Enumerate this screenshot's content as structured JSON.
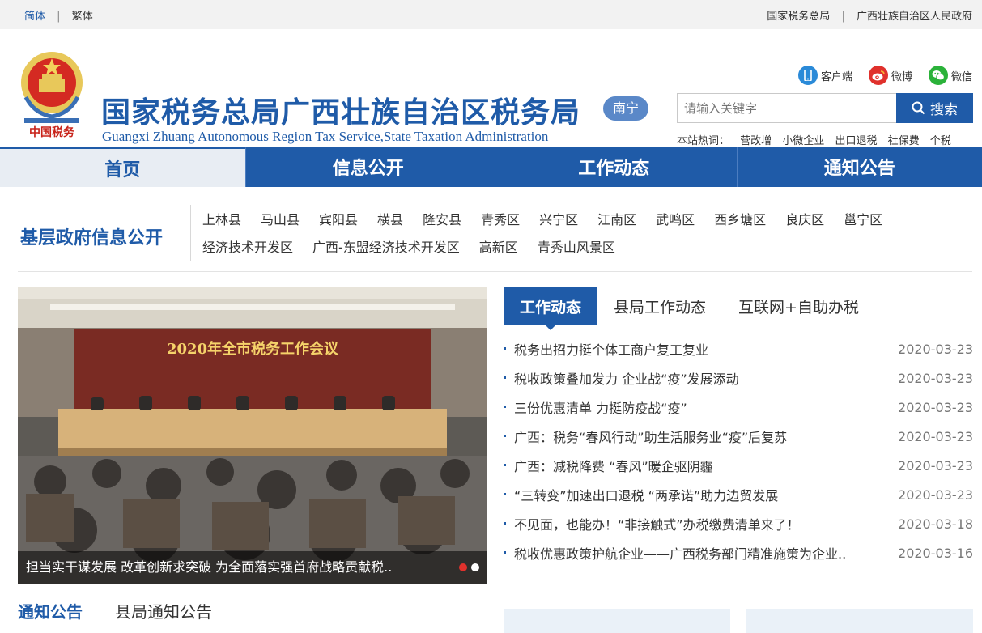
{
  "topbar": {
    "lang_simplified": "简体",
    "lang_traditional": "繁体",
    "link_sat": "国家税务总局",
    "link_gov": "广西壮族自治区人民政府"
  },
  "header": {
    "title_cn": "国家税务总局广西壮族自治区税务局",
    "title_en": "Guangxi Zhuang Autonomous Region Tax Service,State Taxation Administration",
    "city": "南宁",
    "emblem_text": "中国税务",
    "social": [
      {
        "label": "客户端",
        "icon": "phone-icon"
      },
      {
        "label": "微博",
        "icon": "weibo-icon"
      },
      {
        "label": "微信",
        "icon": "wechat-icon"
      }
    ],
    "search_placeholder": "请输入关键字",
    "search_button": "搜索",
    "hot_label": "本站热词：",
    "hot_words": [
      "营改增",
      "小微企业",
      "出口退税",
      "社保费",
      "个税"
    ]
  },
  "nav": [
    {
      "label": "首页",
      "active": true
    },
    {
      "label": "信息公开",
      "active": false
    },
    {
      "label": "工作动态",
      "active": false
    },
    {
      "label": "通知公告",
      "active": false
    }
  ],
  "grassroots": {
    "title": "基层政府信息公开",
    "items": [
      "上林县",
      "马山县",
      "宾阳县",
      "横县",
      "隆安县",
      "青秀区",
      "兴宁区",
      "江南区",
      "武鸣区",
      "西乡塘区",
      "良庆区",
      "邕宁区",
      "经济技术开发区",
      "广西-东盟经济技术开发区",
      "高新区",
      "青秀山风景区"
    ]
  },
  "slider": {
    "banner_text": "2020年全市税务工作会议",
    "caption": "担当实干谋发展 改革创新求突破 为全面落实强首府战略贡献税.."
  },
  "news": {
    "tabs": [
      "工作动态",
      "县局工作动态",
      "互联网+自助办税"
    ],
    "items": [
      {
        "title": "税务出招力挺个体工商户复工复业",
        "date": "2020-03-23"
      },
      {
        "title": "税收政策叠加发力 企业战“疫”发展添动",
        "date": "2020-03-23"
      },
      {
        "title": "三份优惠清单 力挺防疫战“疫”",
        "date": "2020-03-23"
      },
      {
        "title": "广西：税务“春风行动”助生活服务业“疫”后复苏",
        "date": "2020-03-23"
      },
      {
        "title": "广西：减税降费 “春风”暖企驱阴霾",
        "date": "2020-03-23"
      },
      {
        "title": "“三转变”加速出口退税 “两承诺”助力边贸发展",
        "date": "2020-03-23"
      },
      {
        "title": "不见面，也能办！“非接触式”办税缴费清单来了！",
        "date": "2020-03-18"
      },
      {
        "title": "税收优惠政策护航企业——广西税务部门精准施策为企业..",
        "date": "2020-03-16"
      }
    ]
  },
  "notice": {
    "tabs": [
      "通知公告",
      "县局通知公告"
    ]
  },
  "colors": {
    "brand": "#1f5ba8",
    "accent_red": "#e0312c"
  }
}
